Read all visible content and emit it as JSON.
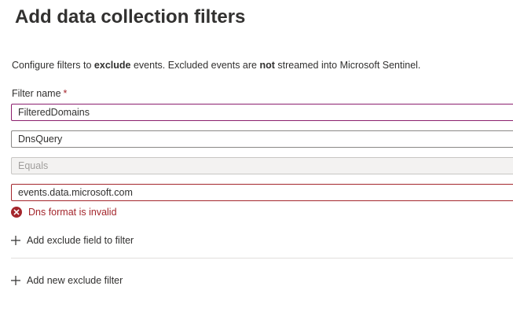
{
  "header": {
    "title": "Add data collection filters"
  },
  "description": {
    "part1": "Configure filters to ",
    "bold1": "exclude",
    "part2": " events. Excluded events are ",
    "bold2": "not",
    "part3": " streamed into Microsoft Sentinel."
  },
  "filter": {
    "name_label": "Filter name",
    "required_marker": "*",
    "name_value": "FilteredDomains",
    "field_value": "DnsQuery",
    "operator_value": "Equals",
    "match_value": "events.data.microsoft.com",
    "error_message": "Dns format is invalid"
  },
  "actions": {
    "add_field_label": "Add exclude field to filter",
    "add_filter_label": "Add new exclude filter"
  },
  "colors": {
    "error": "#a4262c",
    "focus": "#8c1f6e",
    "text": "#323130"
  },
  "icons": {
    "error": "error-circle-icon",
    "add": "plus-icon"
  }
}
